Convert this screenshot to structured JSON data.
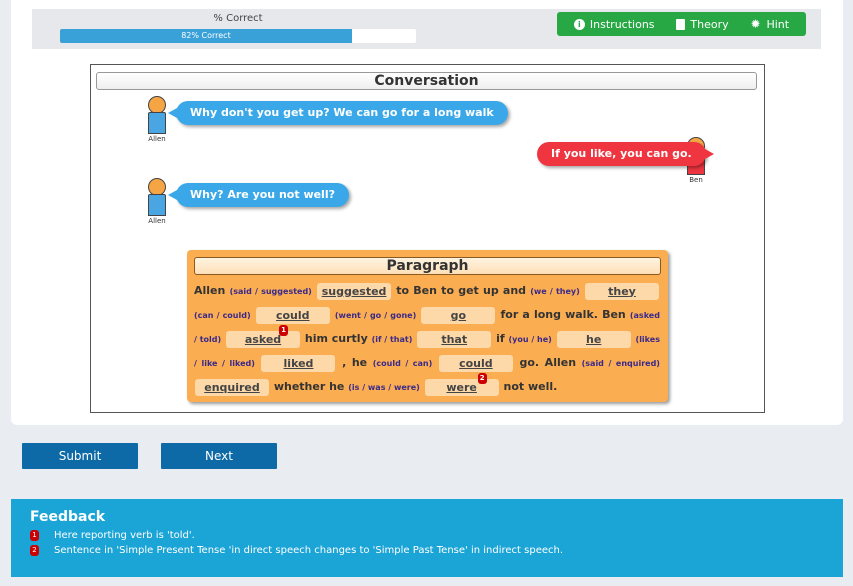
{
  "progress": {
    "label": "% Correct",
    "bar_text": "82% Correct",
    "percent": 82
  },
  "toolbar": {
    "instructions": "Instructions",
    "theory": "Theory",
    "hint": "Hint"
  },
  "conversation": {
    "title": "Conversation",
    "lines": [
      {
        "speaker": "Allen",
        "text": "Why don't you get up? We can go for a long walk"
      },
      {
        "speaker": "Ben",
        "text": "If you like, you can go."
      },
      {
        "speaker": "Allen",
        "text": "Why? Are you not well?"
      }
    ]
  },
  "paragraph": {
    "title": "Paragraph",
    "segments": {
      "t1": "Allen",
      "o1": "(said / suggested)",
      "a1": "suggested",
      "t2": "to Ben to get up and",
      "o2": "(we / they)",
      "a2": "they",
      "o3": "(can / could)",
      "a3": "could",
      "o4": "(went / go / gone)",
      "a4": "go",
      "t3": "for a long walk. Ben",
      "o5": "(asked / told)",
      "a5": "asked",
      "t4": "him curtly",
      "o6": "(if / that)",
      "a6": "that",
      "t5": "if",
      "o7": "(you / he)",
      "a7": "he",
      "o8": "(likes / like / liked)",
      "a8": "liked",
      "t6": ", he",
      "o9": "(could / can)",
      "a9": "could",
      "t7": "go. Allen",
      "o10": "(said / enquired)",
      "a10": "enquired",
      "t8": "whether he",
      "o11": "(is / was / were)",
      "a11": "were",
      "t9": "not well."
    }
  },
  "buttons": {
    "submit": "Submit",
    "next": "Next"
  },
  "feedback": {
    "title": "Feedback",
    "items": [
      {
        "marker": "1",
        "text": "Here reporting verb is 'told'."
      },
      {
        "marker": "2",
        "text": "Sentence in 'Simple Present Tense 'in direct speech changes to 'Simple Past Tense' in indirect speech."
      }
    ]
  },
  "colors": {
    "accent": "#0d6aa6",
    "progress": "#3aa0d8",
    "tools": "#27a844",
    "feedback": "#1ba4d6",
    "paragraph": "#fbad52",
    "allen": "#3aa8e8",
    "ben": "#ee3540",
    "marker": "#cc0000"
  }
}
